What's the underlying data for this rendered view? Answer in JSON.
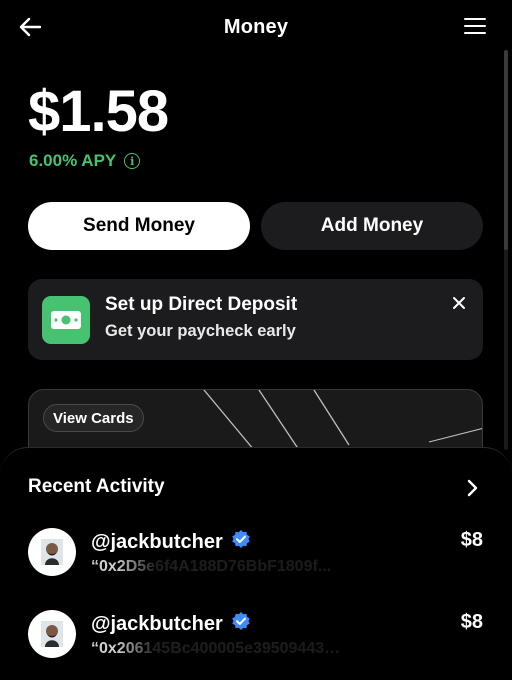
{
  "header": {
    "title": "Money",
    "back_icon": "arrow-left-icon",
    "menu_icon": "hamburger-menu-icon"
  },
  "balance": {
    "amount": "$1.58",
    "apy": "6.00% APY",
    "apy_info_glyph": "i"
  },
  "actions": {
    "send_label": "Send Money",
    "add_label": "Add Money"
  },
  "direct_deposit": {
    "title": "Set up Direct Deposit",
    "subtitle": "Get your paycheck early",
    "icon": "cash-icon",
    "close_icon": "close-icon"
  },
  "cards": {
    "view_label": "View Cards"
  },
  "activity": {
    "title": "Recent Activity",
    "items": [
      {
        "handle": "@jackbutcher",
        "amount": "$8",
        "note": "“0x2D5e6f4A188D76BbF1809f... ",
        "verified": true
      },
      {
        "handle": "@jackbutcher",
        "amount": "$8",
        "note": "“0x206145Bc400005e39509443…",
        "verified": true
      }
    ]
  },
  "colors": {
    "accent_green": "#47c270",
    "verified_blue": "#3d8bfd",
    "surface": "#1c1c1e",
    "background": "#000000"
  }
}
